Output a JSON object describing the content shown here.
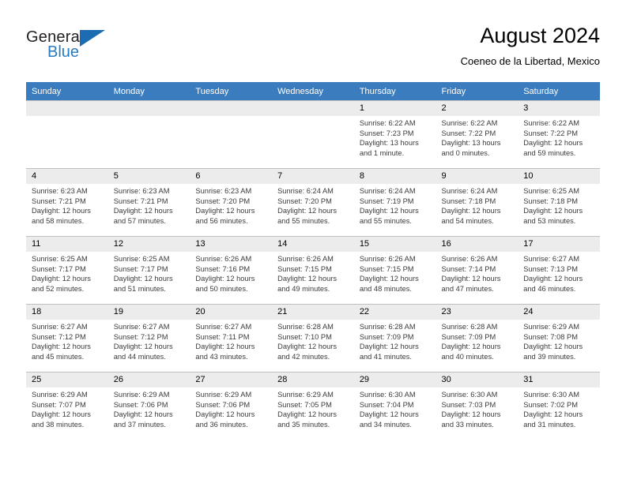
{
  "brand": {
    "name_part1": "General",
    "name_part2": "Blue",
    "triangle_color": "#1b6cb0",
    "blue_color": "#2a7bc0"
  },
  "header": {
    "title": "August 2024",
    "subtitle": "Coeneo de la Libertad, Mexico"
  },
  "calendar": {
    "header_bg": "#3a7cbe",
    "daynum_bg": "#ececec",
    "weekdays": [
      "Sunday",
      "Monday",
      "Tuesday",
      "Wednesday",
      "Thursday",
      "Friday",
      "Saturday"
    ],
    "weeks": [
      [
        {
          "day": "",
          "sunrise": "",
          "sunset": "",
          "daylight": "",
          "daylight2": ""
        },
        {
          "day": "",
          "sunrise": "",
          "sunset": "",
          "daylight": "",
          "daylight2": ""
        },
        {
          "day": "",
          "sunrise": "",
          "sunset": "",
          "daylight": "",
          "daylight2": ""
        },
        {
          "day": "",
          "sunrise": "",
          "sunset": "",
          "daylight": "",
          "daylight2": ""
        },
        {
          "day": "1",
          "sunrise": "Sunrise: 6:22 AM",
          "sunset": "Sunset: 7:23 PM",
          "daylight": "Daylight: 13 hours",
          "daylight2": "and 1 minute."
        },
        {
          "day": "2",
          "sunrise": "Sunrise: 6:22 AM",
          "sunset": "Sunset: 7:22 PM",
          "daylight": "Daylight: 13 hours",
          "daylight2": "and 0 minutes."
        },
        {
          "day": "3",
          "sunrise": "Sunrise: 6:22 AM",
          "sunset": "Sunset: 7:22 PM",
          "daylight": "Daylight: 12 hours",
          "daylight2": "and 59 minutes."
        }
      ],
      [
        {
          "day": "4",
          "sunrise": "Sunrise: 6:23 AM",
          "sunset": "Sunset: 7:21 PM",
          "daylight": "Daylight: 12 hours",
          "daylight2": "and 58 minutes."
        },
        {
          "day": "5",
          "sunrise": "Sunrise: 6:23 AM",
          "sunset": "Sunset: 7:21 PM",
          "daylight": "Daylight: 12 hours",
          "daylight2": "and 57 minutes."
        },
        {
          "day": "6",
          "sunrise": "Sunrise: 6:23 AM",
          "sunset": "Sunset: 7:20 PM",
          "daylight": "Daylight: 12 hours",
          "daylight2": "and 56 minutes."
        },
        {
          "day": "7",
          "sunrise": "Sunrise: 6:24 AM",
          "sunset": "Sunset: 7:20 PM",
          "daylight": "Daylight: 12 hours",
          "daylight2": "and 55 minutes."
        },
        {
          "day": "8",
          "sunrise": "Sunrise: 6:24 AM",
          "sunset": "Sunset: 7:19 PM",
          "daylight": "Daylight: 12 hours",
          "daylight2": "and 55 minutes."
        },
        {
          "day": "9",
          "sunrise": "Sunrise: 6:24 AM",
          "sunset": "Sunset: 7:18 PM",
          "daylight": "Daylight: 12 hours",
          "daylight2": "and 54 minutes."
        },
        {
          "day": "10",
          "sunrise": "Sunrise: 6:25 AM",
          "sunset": "Sunset: 7:18 PM",
          "daylight": "Daylight: 12 hours",
          "daylight2": "and 53 minutes."
        }
      ],
      [
        {
          "day": "11",
          "sunrise": "Sunrise: 6:25 AM",
          "sunset": "Sunset: 7:17 PM",
          "daylight": "Daylight: 12 hours",
          "daylight2": "and 52 minutes."
        },
        {
          "day": "12",
          "sunrise": "Sunrise: 6:25 AM",
          "sunset": "Sunset: 7:17 PM",
          "daylight": "Daylight: 12 hours",
          "daylight2": "and 51 minutes."
        },
        {
          "day": "13",
          "sunrise": "Sunrise: 6:26 AM",
          "sunset": "Sunset: 7:16 PM",
          "daylight": "Daylight: 12 hours",
          "daylight2": "and 50 minutes."
        },
        {
          "day": "14",
          "sunrise": "Sunrise: 6:26 AM",
          "sunset": "Sunset: 7:15 PM",
          "daylight": "Daylight: 12 hours",
          "daylight2": "and 49 minutes."
        },
        {
          "day": "15",
          "sunrise": "Sunrise: 6:26 AM",
          "sunset": "Sunset: 7:15 PM",
          "daylight": "Daylight: 12 hours",
          "daylight2": "and 48 minutes."
        },
        {
          "day": "16",
          "sunrise": "Sunrise: 6:26 AM",
          "sunset": "Sunset: 7:14 PM",
          "daylight": "Daylight: 12 hours",
          "daylight2": "and 47 minutes."
        },
        {
          "day": "17",
          "sunrise": "Sunrise: 6:27 AM",
          "sunset": "Sunset: 7:13 PM",
          "daylight": "Daylight: 12 hours",
          "daylight2": "and 46 minutes."
        }
      ],
      [
        {
          "day": "18",
          "sunrise": "Sunrise: 6:27 AM",
          "sunset": "Sunset: 7:12 PM",
          "daylight": "Daylight: 12 hours",
          "daylight2": "and 45 minutes."
        },
        {
          "day": "19",
          "sunrise": "Sunrise: 6:27 AM",
          "sunset": "Sunset: 7:12 PM",
          "daylight": "Daylight: 12 hours",
          "daylight2": "and 44 minutes."
        },
        {
          "day": "20",
          "sunrise": "Sunrise: 6:27 AM",
          "sunset": "Sunset: 7:11 PM",
          "daylight": "Daylight: 12 hours",
          "daylight2": "and 43 minutes."
        },
        {
          "day": "21",
          "sunrise": "Sunrise: 6:28 AM",
          "sunset": "Sunset: 7:10 PM",
          "daylight": "Daylight: 12 hours",
          "daylight2": "and 42 minutes."
        },
        {
          "day": "22",
          "sunrise": "Sunrise: 6:28 AM",
          "sunset": "Sunset: 7:09 PM",
          "daylight": "Daylight: 12 hours",
          "daylight2": "and 41 minutes."
        },
        {
          "day": "23",
          "sunrise": "Sunrise: 6:28 AM",
          "sunset": "Sunset: 7:09 PM",
          "daylight": "Daylight: 12 hours",
          "daylight2": "and 40 minutes."
        },
        {
          "day": "24",
          "sunrise": "Sunrise: 6:29 AM",
          "sunset": "Sunset: 7:08 PM",
          "daylight": "Daylight: 12 hours",
          "daylight2": "and 39 minutes."
        }
      ],
      [
        {
          "day": "25",
          "sunrise": "Sunrise: 6:29 AM",
          "sunset": "Sunset: 7:07 PM",
          "daylight": "Daylight: 12 hours",
          "daylight2": "and 38 minutes."
        },
        {
          "day": "26",
          "sunrise": "Sunrise: 6:29 AM",
          "sunset": "Sunset: 7:06 PM",
          "daylight": "Daylight: 12 hours",
          "daylight2": "and 37 minutes."
        },
        {
          "day": "27",
          "sunrise": "Sunrise: 6:29 AM",
          "sunset": "Sunset: 7:06 PM",
          "daylight": "Daylight: 12 hours",
          "daylight2": "and 36 minutes."
        },
        {
          "day": "28",
          "sunrise": "Sunrise: 6:29 AM",
          "sunset": "Sunset: 7:05 PM",
          "daylight": "Daylight: 12 hours",
          "daylight2": "and 35 minutes."
        },
        {
          "day": "29",
          "sunrise": "Sunrise: 6:30 AM",
          "sunset": "Sunset: 7:04 PM",
          "daylight": "Daylight: 12 hours",
          "daylight2": "and 34 minutes."
        },
        {
          "day": "30",
          "sunrise": "Sunrise: 6:30 AM",
          "sunset": "Sunset: 7:03 PM",
          "daylight": "Daylight: 12 hours",
          "daylight2": "and 33 minutes."
        },
        {
          "day": "31",
          "sunrise": "Sunrise: 6:30 AM",
          "sunset": "Sunset: 7:02 PM",
          "daylight": "Daylight: 12 hours",
          "daylight2": "and 31 minutes."
        }
      ]
    ]
  }
}
